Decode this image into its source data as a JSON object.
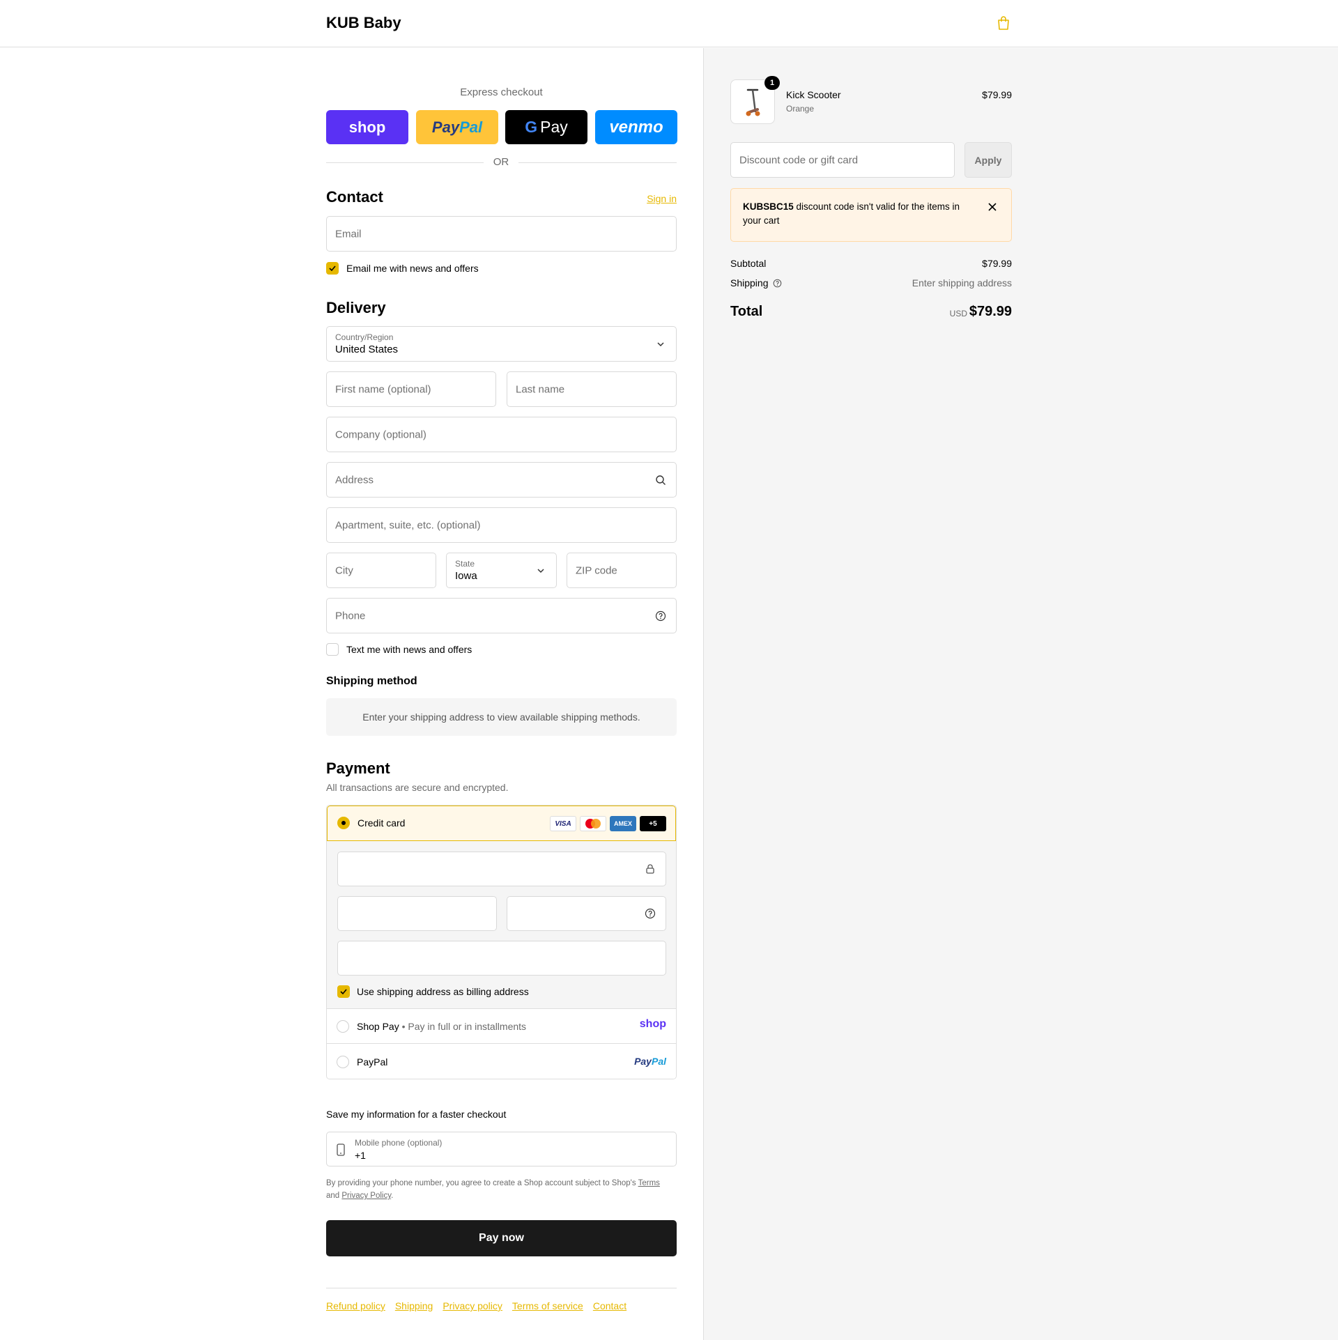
{
  "header": {
    "brand": "KUB Baby",
    "cart_icon": "shopping-bag-icon"
  },
  "express": {
    "label": "Express checkout",
    "shop": "shop",
    "paypal_a": "Pay",
    "paypal_b": "Pal",
    "gpay_g": "G",
    "gpay": "Pay",
    "venmo": "venmo",
    "or": "OR"
  },
  "contact": {
    "title": "Contact",
    "signin": "Sign in",
    "email_placeholder": "Email",
    "news_label": "Email me with news and offers"
  },
  "delivery": {
    "title": "Delivery",
    "country_label": "Country/Region",
    "country_value": "United States",
    "first_name": "First name (optional)",
    "last_name": "Last name",
    "company": "Company (optional)",
    "address": "Address",
    "apartment": "Apartment, suite, etc. (optional)",
    "city": "City",
    "state_label": "State",
    "state_value": "Iowa",
    "zip": "ZIP code",
    "phone": "Phone",
    "text_label": "Text me with news and offers"
  },
  "shipping_method": {
    "title": "Shipping method",
    "message": "Enter your shipping address to view available shipping methods."
  },
  "payment": {
    "title": "Payment",
    "subtitle": "All transactions are secure and encrypted.",
    "credit_card": "Credit card",
    "cards": {
      "visa": "VISA",
      "amex": "AMEX",
      "more": "+5"
    },
    "billing_label": "Use shipping address as billing address",
    "shop_pay": "Shop Pay",
    "shop_pay_sub": "Pay in full or in installments",
    "shop_logo": "shop",
    "paypal": "PayPal",
    "paypal_logo_a": "Pay",
    "paypal_logo_b": "Pal"
  },
  "save_info": {
    "title": "Save my information for a faster checkout",
    "mobile_label": "Mobile phone (optional)",
    "mobile_value": "+1",
    "legal_a": "By providing your phone number, you agree to create a Shop account subject to Shop's",
    "terms": "Terms",
    "legal_and": "and",
    "privacy": "Privacy Policy",
    "legal_end": "."
  },
  "pay_now": "Pay now",
  "footer": [
    "Refund policy",
    "Shipping",
    "Privacy policy",
    "Terms of service",
    "Contact"
  ],
  "summary": {
    "item": {
      "name": "Kick Scooter",
      "variant": "Orange",
      "price": "$79.99",
      "qty": "1"
    },
    "discount_placeholder": "Discount code or gift card",
    "apply": "Apply",
    "alert_code": "KUBSBC15",
    "alert_text": "discount code isn't valid for the items in your cart",
    "subtotal_label": "Subtotal",
    "subtotal": "$79.99",
    "shipping_label": "Shipping",
    "shipping": "Enter shipping address",
    "total_label": "Total",
    "currency": "USD",
    "total": "$79.99"
  },
  "colors": {
    "accent": "#e6b800",
    "shop": "#5a31f4",
    "paypal": "#ffc439",
    "venmo": "#008cff"
  }
}
